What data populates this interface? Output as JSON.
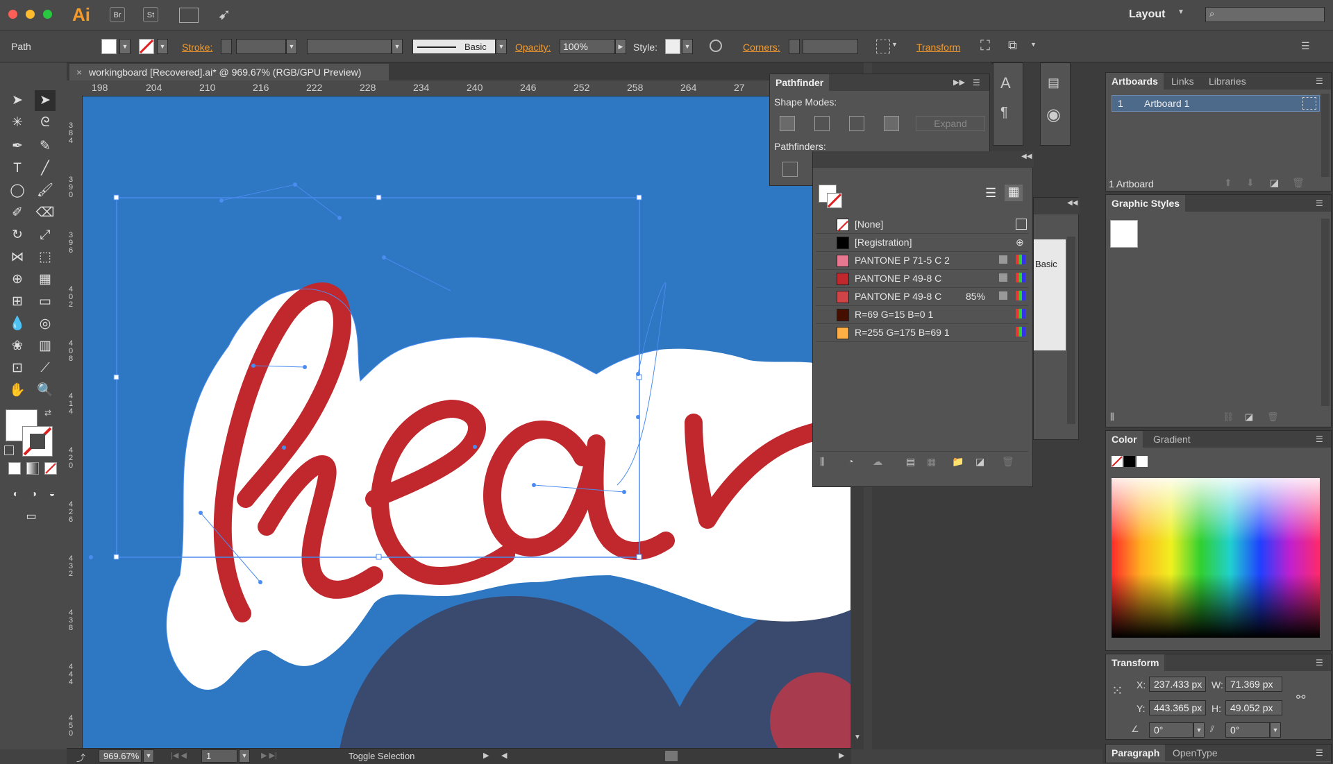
{
  "titlebar": {
    "app_logo": "Ai",
    "buttons": [
      "Br",
      "St"
    ],
    "workspace_label": "Layout",
    "search_placeholder": ""
  },
  "controlbar": {
    "selection_label": "Path",
    "stroke_label": "Stroke:",
    "profile_label": "Basic",
    "opacity_label": "Opacity:",
    "opacity_value": "100%",
    "style_label": "Style:",
    "corners_label": "Corners:",
    "transform_label": "Transform"
  },
  "document": {
    "tab_title": "workingboard [Recovered].ai* @ 969.67% (RGB/GPU Preview)",
    "hruler_ticks": [
      "198",
      "204",
      "210",
      "216",
      "222",
      "228",
      "234",
      "240",
      "246",
      "252",
      "258",
      "264",
      "27"
    ],
    "vruler_ticks": [
      "384",
      "390",
      "396",
      "402",
      "408",
      "414",
      "420",
      "426",
      "432",
      "438",
      "444",
      "450"
    ],
    "zoom_value": "969.67%",
    "artboard_nav_value": "1",
    "status_text": "Toggle Selection"
  },
  "pathfinder": {
    "title": "Pathfinder",
    "shape_modes_label": "Shape Modes:",
    "expand_label": "Expand",
    "pathfinders_label": "Pathfinders:"
  },
  "swatches": {
    "items": [
      {
        "name": "[None]",
        "color": "none",
        "extra": ""
      },
      {
        "name": "[Registration]",
        "color": "#000000",
        "extra": ""
      },
      {
        "name": "PANTONE P 71-5 C 2",
        "color": "#e8788f",
        "extra": ""
      },
      {
        "name": "PANTONE P 49-8 C",
        "color": "#c0282d",
        "extra": ""
      },
      {
        "name": "PANTONE P 49-8 C",
        "color": "#d04448",
        "extra": "85%"
      },
      {
        "name": "R=69 G=15 B=0 1",
        "color": "#450f00",
        "extra": ""
      },
      {
        "name": "R=255 G=175 B=69 1",
        "color": "#ffaf45",
        "extra": ""
      }
    ]
  },
  "brushes_partial_label": "Basic",
  "artboards": {
    "tabs": [
      "Artboards",
      "Links",
      "Libraries"
    ],
    "row_number": "1",
    "row_name": "Artboard 1",
    "count_label": "1 Artboard"
  },
  "graphic_styles": {
    "title": "Graphic Styles"
  },
  "color_panel": {
    "tabs": [
      "Color",
      "Gradient"
    ]
  },
  "transform": {
    "title": "Transform",
    "x_label": "X:",
    "x_value": "237.433 px",
    "y_label": "Y:",
    "y_value": "443.365 px",
    "w_label": "W:",
    "w_value": "71.369 px",
    "h_label": "H:",
    "h_value": "49.052 px",
    "rotate_value": "0°",
    "shear_value": "0°"
  },
  "paragraph": {
    "tabs": [
      "Paragraph",
      "OpenType"
    ]
  },
  "colors": {
    "canvas_blue": "#2e77c2",
    "letter_red": "#c0282d",
    "shape_navy": "#3a4a6e",
    "accent_orange": "#f39a2b",
    "selection_blue": "#4a8cf0"
  }
}
